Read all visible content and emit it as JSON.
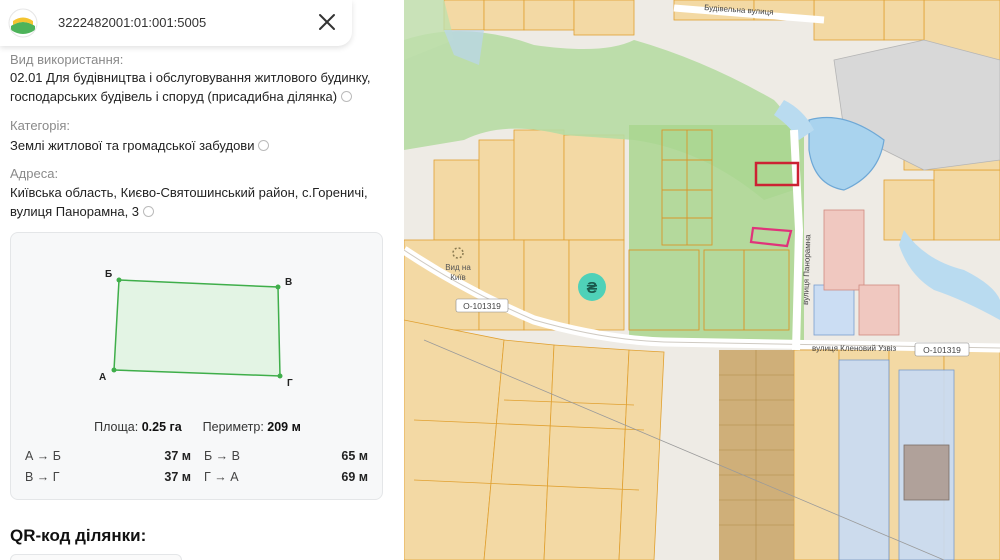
{
  "panel": {
    "cadastral_number": "3222482001:01:001:5005",
    "usage": {
      "label": "Вид використання:",
      "line1": "02.01 Для будівництва і обслуговування житлового будинку,",
      "line2": "господарських будівель і споруд (присадибна ділянка)"
    },
    "category": {
      "label": "Категорія:",
      "value": "Землі житлової та громадської забудови"
    },
    "address": {
      "label": "Адреса:",
      "line1": "Київська область, Києво-Святошинський район, с.Гореничі,",
      "line2": "вулиця Панорамна, 3"
    },
    "shape": {
      "vertices": [
        "Б",
        "В",
        "А",
        "Г"
      ],
      "area_label": "Площа:",
      "area_value": "0.25 га",
      "perimeter_label": "Периметр:",
      "perimeter_value": "209 м",
      "segments": [
        {
          "name": "А → Б",
          "value": "37 м"
        },
        {
          "name": "Б → В",
          "value": "65 м"
        },
        {
          "name": "В → Г",
          "value": "37 м"
        },
        {
          "name": "Г → А",
          "value": "69 м"
        }
      ]
    },
    "qr_title": "QR-код ділянки:"
  },
  "map": {
    "streets": {
      "budivelna": "Будівельна вулиця",
      "panoramna": "вулиця Панорамна",
      "klenovyi": "вулиця Кленовий Узвіз",
      "road_code_1": "О-101319",
      "road_code_2": "О-101319"
    },
    "poi": {
      "line1": "Вид на",
      "line2": "Київ"
    },
    "currency_marker": "₴",
    "colors": {
      "parcel_fill": "#f3d9a4",
      "parcel_border": "#e0a030",
      "forest": "#b6dca3",
      "selected_parcel": "#cc2233",
      "other_selected": "#e0337a",
      "water": "#a9d3ee",
      "marker": "#4fd1b8"
    }
  }
}
